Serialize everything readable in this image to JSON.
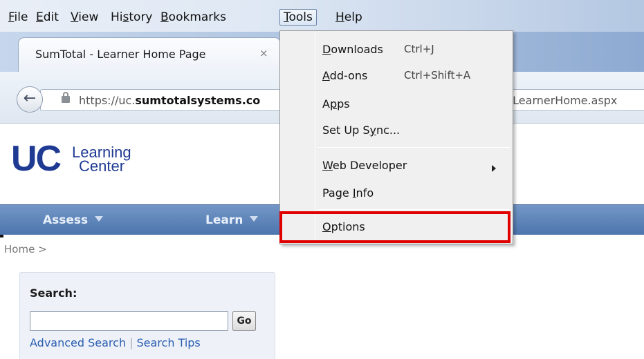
{
  "menubar": {
    "items": [
      {
        "pre": "",
        "mn": "F",
        "post": "ile"
      },
      {
        "pre": "",
        "mn": "E",
        "post": "dit"
      },
      {
        "pre": "",
        "mn": "V",
        "post": "iew"
      },
      {
        "pre": "Hi",
        "mn": "s",
        "post": "tory"
      },
      {
        "pre": "",
        "mn": "B",
        "post": "ookmarks"
      },
      {
        "pre": "",
        "mn": "T",
        "post": "ools"
      },
      {
        "pre": "",
        "mn": "H",
        "post": "elp"
      }
    ]
  },
  "tab": {
    "title": "SumTotal - Learner Home Page",
    "close": "×"
  },
  "navbar": {
    "back": "←",
    "url_prefix": "https://uc.",
    "url_domain": "sumtotalsystems.co",
    "url_suffix": "S_LearnerHome.aspx"
  },
  "logo": {
    "uc": "UC",
    "line1": "Learning",
    "line2": "Center"
  },
  "nav": {
    "assess": "Assess",
    "learn": "Learn"
  },
  "breadcrumb": "Home >",
  "search": {
    "label": "Search:",
    "go": "Go",
    "advanced": "Advanced Search",
    "sep": "|",
    "tips": "Search Tips"
  },
  "tools_menu": {
    "downloads": {
      "mn": "D",
      "rest": "ownloads",
      "shortcut": "Ctrl+J"
    },
    "addons": {
      "mn": "A",
      "rest": "dd-ons",
      "shortcut": "Ctrl+Shift+A"
    },
    "apps": {
      "pre": "A",
      "mn": "p",
      "rest": "ps"
    },
    "sync": {
      "pre": "Set Up S",
      "mn": "y",
      "rest": "nc..."
    },
    "webdev": {
      "mn": "W",
      "rest": "eb Developer"
    },
    "pageinfo": {
      "pre": "Page ",
      "mn": "I",
      "rest": "nfo"
    },
    "options": {
      "mn": "O",
      "rest": "ptions"
    }
  }
}
